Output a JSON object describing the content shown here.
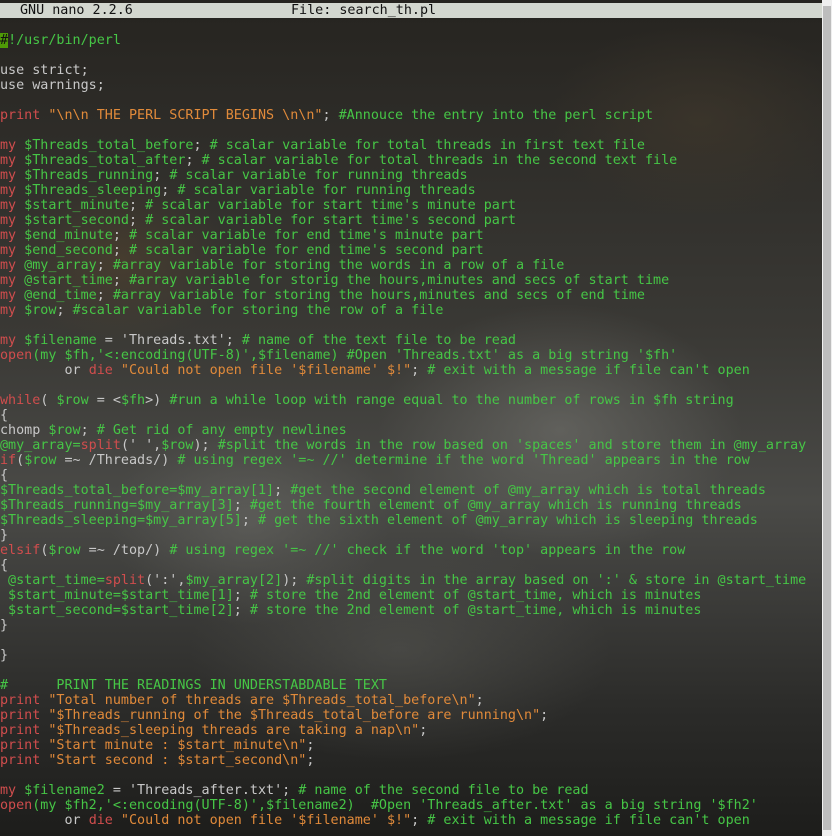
{
  "titlebar": {
    "app": "GNU nano 2.2.6",
    "file": "File: search_th.pl"
  },
  "lines": [
    [
      {
        "c": "cursor",
        "t": "#"
      },
      {
        "c": "com",
        "t": "!/usr/bin/perl"
      }
    ],
    [],
    [
      {
        "c": "plain",
        "t": "use strict;"
      }
    ],
    [
      {
        "c": "plain",
        "t": "use warnings;"
      }
    ],
    [],
    [
      {
        "c": "kw",
        "t": "print"
      },
      {
        "c": "str",
        "t": " \"\\n\\n THE PERL SCRIPT BEGINS \\n\\n\""
      },
      {
        "c": "plain",
        "t": "; "
      },
      {
        "c": "com",
        "t": "#Annouce the entry into the perl script"
      }
    ],
    [],
    [
      {
        "c": "kw",
        "t": "my"
      },
      {
        "c": "var",
        "t": " $Threads_total_before"
      },
      {
        "c": "plain",
        "t": "; "
      },
      {
        "c": "com",
        "t": "# scalar variable for total threads in first text file"
      }
    ],
    [
      {
        "c": "kw",
        "t": "my"
      },
      {
        "c": "var",
        "t": " $Threads_total_after"
      },
      {
        "c": "plain",
        "t": "; "
      },
      {
        "c": "com",
        "t": "# scalar variable for total threads in the second text file"
      }
    ],
    [
      {
        "c": "kw",
        "t": "my"
      },
      {
        "c": "var",
        "t": " $Threads_running"
      },
      {
        "c": "plain",
        "t": "; "
      },
      {
        "c": "com",
        "t": "# scalar variable for running threads"
      }
    ],
    [
      {
        "c": "kw",
        "t": "my"
      },
      {
        "c": "var",
        "t": " $Threads_sleeping"
      },
      {
        "c": "plain",
        "t": "; "
      },
      {
        "c": "com",
        "t": "# scalar variable for running threads"
      }
    ],
    [
      {
        "c": "kw",
        "t": "my"
      },
      {
        "c": "var",
        "t": " $start_minute"
      },
      {
        "c": "plain",
        "t": "; "
      },
      {
        "c": "com",
        "t": "# scalar variable for start time's minute part"
      }
    ],
    [
      {
        "c": "kw",
        "t": "my"
      },
      {
        "c": "var",
        "t": " $start_second"
      },
      {
        "c": "plain",
        "t": "; "
      },
      {
        "c": "com",
        "t": "# scalar variable for start time's second part"
      }
    ],
    [
      {
        "c": "kw",
        "t": "my"
      },
      {
        "c": "var",
        "t": " $end_minute"
      },
      {
        "c": "plain",
        "t": "; "
      },
      {
        "c": "com",
        "t": "# scalar variable for end time's minute part"
      }
    ],
    [
      {
        "c": "kw",
        "t": "my"
      },
      {
        "c": "var",
        "t": " $end_second"
      },
      {
        "c": "plain",
        "t": "; "
      },
      {
        "c": "com",
        "t": "# scalar variable for end time's second part"
      }
    ],
    [
      {
        "c": "kw",
        "t": "my"
      },
      {
        "c": "var",
        "t": " @my_array"
      },
      {
        "c": "plain",
        "t": "; "
      },
      {
        "c": "com",
        "t": "#array variable for storing the words in a row of a file"
      }
    ],
    [
      {
        "c": "kw",
        "t": "my"
      },
      {
        "c": "var",
        "t": " @start_time"
      },
      {
        "c": "plain",
        "t": "; "
      },
      {
        "c": "com",
        "t": "#array variable for storig the hours,minutes and secs of start time"
      }
    ],
    [
      {
        "c": "kw",
        "t": "my"
      },
      {
        "c": "var",
        "t": " @end_time"
      },
      {
        "c": "plain",
        "t": "; "
      },
      {
        "c": "com",
        "t": "#array variable for storing the hours,minutes and secs of end time"
      }
    ],
    [
      {
        "c": "kw",
        "t": "my"
      },
      {
        "c": "var",
        "t": " $row"
      },
      {
        "c": "plain",
        "t": "; "
      },
      {
        "c": "com",
        "t": "#scalar variable for storing the row of a file"
      }
    ],
    [],
    [
      {
        "c": "kw",
        "t": "my"
      },
      {
        "c": "var",
        "t": " $filename"
      },
      {
        "c": "plain",
        "t": " = 'Threads.txt'; "
      },
      {
        "c": "com",
        "t": "# name of the text file to be read"
      }
    ],
    [
      {
        "c": "kw",
        "t": "open"
      },
      {
        "c": "var",
        "t": "(my $fh,'<:encoding(UTF-8)',$filename) "
      },
      {
        "c": "com",
        "t": "#Open 'Threads.txt' as a big string '$fh'"
      }
    ],
    [
      {
        "c": "plain",
        "t": "        or "
      },
      {
        "c": "kw",
        "t": "die"
      },
      {
        "c": "str",
        "t": " \"Could not open file '$filename' $!\""
      },
      {
        "c": "plain",
        "t": "; "
      },
      {
        "c": "com",
        "t": "# exit with a message if file can't open"
      }
    ],
    [],
    [
      {
        "c": "kw",
        "t": "while"
      },
      {
        "c": "plain",
        "t": "( "
      },
      {
        "c": "var",
        "t": "$row"
      },
      {
        "c": "plain",
        "t": " = <"
      },
      {
        "c": "var",
        "t": "$fh"
      },
      {
        "c": "plain",
        "t": ">) "
      },
      {
        "c": "com",
        "t": "#run a while loop with range equal to the number of rows in $fh string"
      }
    ],
    [
      {
        "c": "plain",
        "t": "{"
      }
    ],
    [
      {
        "c": "plain",
        "t": "chomp "
      },
      {
        "c": "var",
        "t": "$row"
      },
      {
        "c": "plain",
        "t": "; "
      },
      {
        "c": "com",
        "t": "# Get rid of any empty newlines"
      }
    ],
    [
      {
        "c": "var",
        "t": "@my_array="
      },
      {
        "c": "kw",
        "t": "split"
      },
      {
        "c": "plain",
        "t": "(' ',"
      },
      {
        "c": "var",
        "t": "$row"
      },
      {
        "c": "plain",
        "t": "); "
      },
      {
        "c": "com",
        "t": "#split the words in the row based on 'spaces' and store them in @my_array"
      }
    ],
    [
      {
        "c": "kw",
        "t": "if"
      },
      {
        "c": "plain",
        "t": "("
      },
      {
        "c": "var",
        "t": "$row"
      },
      {
        "c": "plain",
        "t": " =~ /Threads/) "
      },
      {
        "c": "com",
        "t": "# using regex '=~ //' determine if the word 'Thread' appears in the row"
      }
    ],
    [
      {
        "c": "plain",
        "t": "{"
      }
    ],
    [
      {
        "c": "var",
        "t": "$Threads_total_before=$my_array[1]"
      },
      {
        "c": "plain",
        "t": "; "
      },
      {
        "c": "com",
        "t": "#get the second element of @my_array which is total threads"
      }
    ],
    [
      {
        "c": "var",
        "t": "$Threads_running=$my_array[3]"
      },
      {
        "c": "plain",
        "t": "; "
      },
      {
        "c": "com",
        "t": "#get the fourth element of @my_array which is running threads"
      }
    ],
    [
      {
        "c": "var",
        "t": "$Threads_sleeping=$my_array[5]"
      },
      {
        "c": "plain",
        "t": "; "
      },
      {
        "c": "com",
        "t": "# get the sixth element of @my_array which is sleeping threads"
      }
    ],
    [
      {
        "c": "plain",
        "t": "}"
      }
    ],
    [
      {
        "c": "kw",
        "t": "elsif"
      },
      {
        "c": "plain",
        "t": "("
      },
      {
        "c": "var",
        "t": "$row"
      },
      {
        "c": "plain",
        "t": " =~ /top/) "
      },
      {
        "c": "com",
        "t": "# using regex '=~ //' check if the word 'top' appears in the row"
      }
    ],
    [
      {
        "c": "plain",
        "t": "{"
      }
    ],
    [
      {
        "c": "var",
        "t": " @start_time="
      },
      {
        "c": "kw",
        "t": "split"
      },
      {
        "c": "plain",
        "t": "(':',"
      },
      {
        "c": "var",
        "t": "$my_array[2]"
      },
      {
        "c": "plain",
        "t": "); "
      },
      {
        "c": "com",
        "t": "#split digits in the array based on ':' & store in @start_time"
      }
    ],
    [
      {
        "c": "var",
        "t": " $start_minute=$start_time[1]"
      },
      {
        "c": "plain",
        "t": "; "
      },
      {
        "c": "com",
        "t": "# store the 2nd element of @start_time, which is minutes"
      }
    ],
    [
      {
        "c": "var",
        "t": " $start_second=$start_time[2]"
      },
      {
        "c": "plain",
        "t": "; "
      },
      {
        "c": "com",
        "t": "# store the 2nd element of @start_time, which is minutes"
      }
    ],
    [
      {
        "c": "plain",
        "t": "}"
      }
    ],
    [],
    [
      {
        "c": "plain",
        "t": "}"
      }
    ],
    [],
    [
      {
        "c": "com",
        "t": "#      PRINT THE READINGS IN UNDERSTABDABLE TEXT"
      }
    ],
    [
      {
        "c": "kw",
        "t": "print"
      },
      {
        "c": "str",
        "t": " \"Total number of threads are $Threads_total_before\\n\""
      },
      {
        "c": "plain",
        "t": ";"
      }
    ],
    [
      {
        "c": "kw",
        "t": "print"
      },
      {
        "c": "str",
        "t": " \"$Threads_running of the $Threads_total_before are running\\n\""
      },
      {
        "c": "plain",
        "t": ";"
      }
    ],
    [
      {
        "c": "kw",
        "t": "print"
      },
      {
        "c": "str",
        "t": " \"$Threads_sleeping threads are taking a nap\\n\""
      },
      {
        "c": "plain",
        "t": ";"
      }
    ],
    [
      {
        "c": "kw",
        "t": "print"
      },
      {
        "c": "str",
        "t": " \"Start minute : $start_minute\\n\""
      },
      {
        "c": "plain",
        "t": ";"
      }
    ],
    [
      {
        "c": "kw",
        "t": "print"
      },
      {
        "c": "str",
        "t": " \"Start second : $start_second\\n\""
      },
      {
        "c": "plain",
        "t": ";"
      }
    ],
    [],
    [
      {
        "c": "kw",
        "t": "my"
      },
      {
        "c": "var",
        "t": " $filename2"
      },
      {
        "c": "plain",
        "t": " = 'Threads_after.txt'; "
      },
      {
        "c": "com",
        "t": "# name of the second file to be read"
      }
    ],
    [
      {
        "c": "kw",
        "t": "open"
      },
      {
        "c": "var",
        "t": "(my $fh2,'<:encoding(UTF-8)',$filename2)  "
      },
      {
        "c": "com",
        "t": "#Open 'Threads_after.txt' as a big string '$fh2'"
      }
    ],
    [
      {
        "c": "plain",
        "t": "        or "
      },
      {
        "c": "kw",
        "t": "die"
      },
      {
        "c": "str",
        "t": " \"Could not open file '$filename' $!\""
      },
      {
        "c": "plain",
        "t": "; "
      },
      {
        "c": "com",
        "t": "# exit with a message if file can't open"
      }
    ]
  ]
}
